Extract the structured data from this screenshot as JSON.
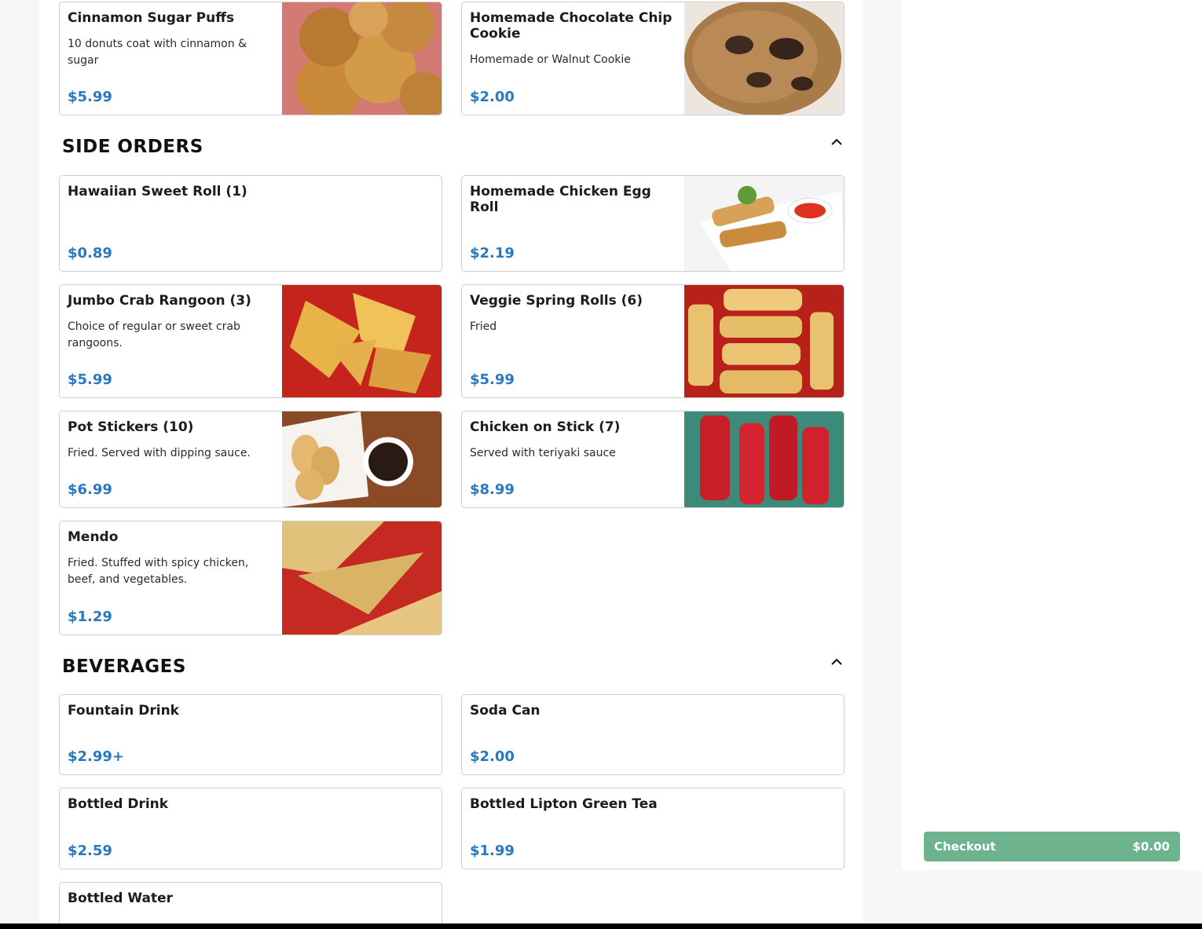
{
  "sections": [
    {
      "title": "SIDE ORDERS"
    },
    {
      "title": "BEVERAGES"
    }
  ],
  "items": {
    "cinnamon_puffs": {
      "name": "Cinnamon Sugar Puffs",
      "desc": "10 donuts coat with cinnamon & sugar",
      "price": "$5.99"
    },
    "choc_cookie": {
      "name": "Homemade Chocolate Chip Cookie",
      "desc": "Homemade or Walnut Cookie",
      "price": "$2.00"
    },
    "hawaiian_roll": {
      "name": "Hawaiian Sweet Roll (1)",
      "desc": "",
      "price": "$0.89"
    },
    "egg_roll": {
      "name": "Homemade Chicken Egg Roll",
      "desc": "",
      "price": "$2.19"
    },
    "crab_rangoon": {
      "name": "Jumbo Crab Rangoon (3)",
      "desc": "Choice of regular or sweet crab rangoons.",
      "price": "$5.99"
    },
    "spring_rolls": {
      "name": "Veggie Spring Rolls (6)",
      "desc": "Fried",
      "price": "$5.99"
    },
    "pot_stickers": {
      "name": "Pot Stickers (10)",
      "desc": "Fried. Served with dipping sauce.",
      "price": "$6.99"
    },
    "chicken_stick": {
      "name": "Chicken on Stick (7)",
      "desc": "Served with teriyaki sauce",
      "price": "$8.99"
    },
    "mendo": {
      "name": "Mendo",
      "desc": "Fried. Stuffed with spicy chicken, beef, and vegetables.",
      "price": "$1.29"
    },
    "fountain": {
      "name": "Fountain Drink",
      "desc": "",
      "price": "$2.99+"
    },
    "soda_can": {
      "name": "Soda Can",
      "desc": "",
      "price": "$2.00"
    },
    "bottled_drink": {
      "name": "Bottled Drink",
      "desc": "",
      "price": "$2.59"
    },
    "lipton": {
      "name": "Bottled Lipton Green Tea",
      "desc": "",
      "price": "$1.99"
    },
    "water": {
      "name": "Bottled Water",
      "desc": "",
      "price": ""
    }
  },
  "cart": {
    "checkout_label": "Checkout",
    "total": "$0.00"
  },
  "icons": {
    "collapse": "chevron-up-icon"
  },
  "colors": {
    "price": "#2a78bd",
    "checkout": "#6db38d"
  }
}
